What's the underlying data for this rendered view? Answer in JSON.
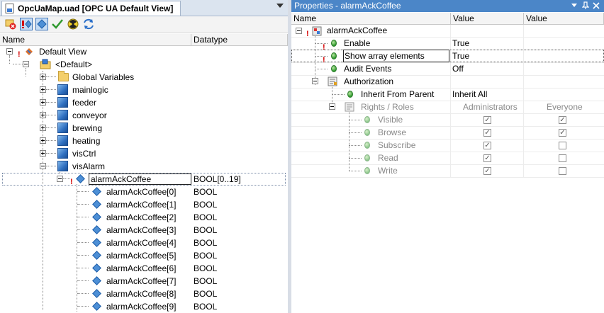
{
  "editor": {
    "tab_title": "OpcUaMap.uad [OPC UA Default View]",
    "columns": {
      "name": "Name",
      "datatype": "Datatype"
    },
    "tree": [
      {
        "label": "Default View",
        "datatype": ""
      },
      {
        "label": "<Default>",
        "datatype": ""
      },
      {
        "label": "Global Variables",
        "datatype": ""
      },
      {
        "label": "mainlogic",
        "datatype": ""
      },
      {
        "label": "feeder",
        "datatype": ""
      },
      {
        "label": "conveyor",
        "datatype": ""
      },
      {
        "label": "brewing",
        "datatype": ""
      },
      {
        "label": "heating",
        "datatype": ""
      },
      {
        "label": "visCtrl",
        "datatype": ""
      },
      {
        "label": "visAlarm",
        "datatype": ""
      },
      {
        "label": "alarmAckCoffee",
        "datatype": "BOOL[0..19]"
      },
      {
        "label": "alarmAckCoffee[0]",
        "datatype": "BOOL"
      },
      {
        "label": "alarmAckCoffee[1]",
        "datatype": "BOOL"
      },
      {
        "label": "alarmAckCoffee[2]",
        "datatype": "BOOL"
      },
      {
        "label": "alarmAckCoffee[3]",
        "datatype": "BOOL"
      },
      {
        "label": "alarmAckCoffee[4]",
        "datatype": "BOOL"
      },
      {
        "label": "alarmAckCoffee[5]",
        "datatype": "BOOL"
      },
      {
        "label": "alarmAckCoffee[6]",
        "datatype": "BOOL"
      },
      {
        "label": "alarmAckCoffee[7]",
        "datatype": "BOOL"
      },
      {
        "label": "alarmAckCoffee[8]",
        "datatype": "BOOL"
      },
      {
        "label": "alarmAckCoffee[9]",
        "datatype": "BOOL"
      }
    ]
  },
  "properties": {
    "title": "Properties - alarmAckCoffee",
    "columns": {
      "name": "Name",
      "value1": "Value",
      "value2": "Value"
    },
    "rows": [
      {
        "name": "alarmAckCoffee",
        "value1": "",
        "value2": ""
      },
      {
        "name": "Enable",
        "value1": "True",
        "value2": ""
      },
      {
        "name": "Show array elements",
        "value1": "True",
        "value2": ""
      },
      {
        "name": "Audit Events",
        "value1": "Off",
        "value2": ""
      },
      {
        "name": "Authorization",
        "value1": "",
        "value2": ""
      },
      {
        "name": "Inherit From Parent",
        "value1": "Inherit All",
        "value2": ""
      },
      {
        "name": "Rights / Roles",
        "value1": "Administrators",
        "value2": "Everyone"
      },
      {
        "name": "Visible",
        "admin": true,
        "everyone": true
      },
      {
        "name": "Browse",
        "admin": true,
        "everyone": true
      },
      {
        "name": "Subscribe",
        "admin": true,
        "everyone": false
      },
      {
        "name": "Read",
        "admin": true,
        "everyone": false
      },
      {
        "name": "Write",
        "admin": true,
        "everyone": false
      }
    ]
  },
  "colors": {
    "accent": "#4b86c8",
    "selection_border": "#222222",
    "warning": "#d40000",
    "ok": "#2f9a2f"
  }
}
